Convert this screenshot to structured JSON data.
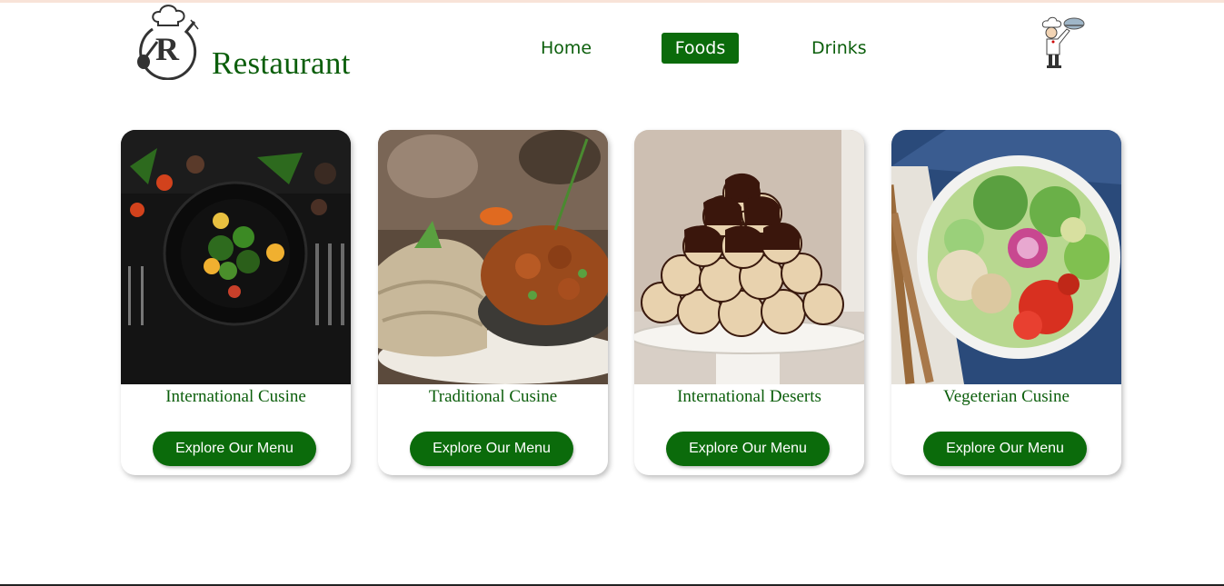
{
  "header": {
    "brand": "Restaurant",
    "logo_letter": "R",
    "logo_icon": "chef-hat-logo-icon",
    "chef_icon": "chef-waiter-icon"
  },
  "nav": {
    "items": [
      {
        "label": "Home",
        "active": false
      },
      {
        "label": "Foods",
        "active": true
      },
      {
        "label": "Drinks",
        "active": false
      }
    ]
  },
  "cards": [
    {
      "title": "International Cusine",
      "button": "Explore Our Menu",
      "image": "plated-salad-photo"
    },
    {
      "title": "Traditional Cusine",
      "button": "Explore Our Menu",
      "image": "injera-and-stew-photo"
    },
    {
      "title": "International Deserts",
      "button": "Explore Our Menu",
      "image": "chocolate-profiteroles-photo"
    },
    {
      "title": "Vegeterian Cusine",
      "button": "Explore Our Menu",
      "image": "salad-bowl-photo"
    }
  ],
  "colors": {
    "accent": "#0b6b0b",
    "text_green": "#0b5e0b",
    "background": "#ffffff"
  }
}
